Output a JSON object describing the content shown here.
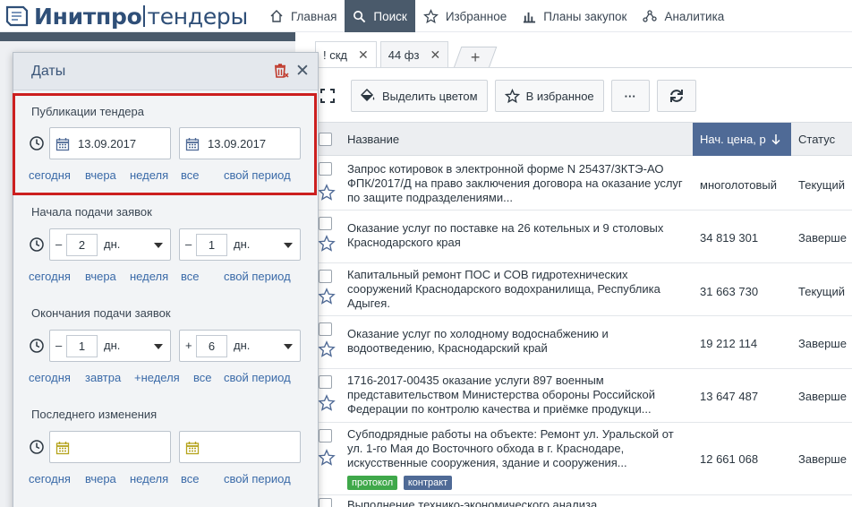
{
  "header": {
    "logo_left": "Инитпро",
    "logo_right": "тендеры",
    "nav": [
      {
        "label": "Главная",
        "icon": "home-icon",
        "active": false
      },
      {
        "label": "Поиск",
        "icon": "search-icon",
        "active": true
      },
      {
        "label": "Избранное",
        "icon": "star-icon",
        "active": false
      },
      {
        "label": "Планы закупок",
        "icon": "bar-chart-icon",
        "active": false
      },
      {
        "label": "Аналитика",
        "icon": "analytics-icon",
        "active": false
      }
    ]
  },
  "tabs": [
    {
      "label": "! скд",
      "close": "✕"
    },
    {
      "label": "44 фз",
      "close": "✕"
    }
  ],
  "tab_add": "+",
  "toolbar": {
    "highlight_label": "Выделить цветом",
    "favorite_label": "В избранное",
    "more_label": "···"
  },
  "grid": {
    "columns": {
      "name": "Название",
      "price": "Нач. цена, р",
      "status": "Статус"
    },
    "rows": [
      {
        "name": "Запрос котировок в электронной форме N 25437/3КТЭ-АО ФПК/2017/Д на право заключения договора на оказание услуг по защите подразделениями...",
        "price": "многолотовый",
        "status": "Текущий"
      },
      {
        "name": "Оказание услуг по поставке на 26 котельных и 9 столовых Краснодарского края",
        "price": "34 819 301",
        "status": "Заверше"
      },
      {
        "name": "Капитальный ремонт ПОС и СОВ гидротехнических сооружений Краснодарского водохранилища, Республика Адыгея.",
        "price": "31 663 730",
        "status": "Текущий"
      },
      {
        "name": "Оказание услуг по холодному водоснабжению и водоотведению, Краснодарский край",
        "price": "19 212 114",
        "status": "Заверше"
      },
      {
        "name": "1716-2017-00435 оказание услуги 897 военным представительством Министерства обороны Российской Федерации по контролю качества и приёмке продукци...",
        "price": "13 647 487",
        "status": "Заверше"
      },
      {
        "name": "Субподрядные работы на объекте: Ремонт ул. Уральской от ул. 1-го Мая до Восточного обхода в г. Краснодаре, искусственные сооружения, здание и сооружения...",
        "price": "12 661 068",
        "status": "Заверше",
        "badges": [
          {
            "label": "протокол",
            "color": "#3fa84a"
          },
          {
            "label": "контракт",
            "color": "#4f6a96"
          }
        ]
      },
      {
        "name": "Выполнение технико-экономического анализа",
        "price": "",
        "status": ""
      }
    ]
  },
  "panel": {
    "title": "Даты",
    "close": "✕",
    "sections": {
      "publication": {
        "title": "Публикации тендера",
        "from": "13.09.2017",
        "to": "13.09.2017",
        "links": [
          "сегодня",
          "вчера",
          "неделя",
          "все",
          "свой период"
        ]
      },
      "start": {
        "title": "Начала подачи заявок",
        "from_sign": "–",
        "from_num": "2",
        "from_unit": "дн.",
        "to_sign": "–",
        "to_num": "1",
        "to_unit": "дн.",
        "links": [
          "сегодня",
          "вчера",
          "неделя",
          "все",
          "свой период"
        ]
      },
      "end": {
        "title": "Окончания подачи заявок",
        "from_sign": "–",
        "from_num": "1",
        "from_unit": "дн.",
        "to_sign": "+",
        "to_num": "6",
        "to_unit": "дн.",
        "links": [
          "сегодня",
          "завтра",
          "+неделя",
          "все",
          "свой период"
        ]
      },
      "modified": {
        "title": "Последнего изменения",
        "from": "",
        "to": "",
        "links": [
          "сегодня",
          "вчера",
          "неделя",
          "все",
          "свой период"
        ]
      }
    }
  },
  "colors": {
    "nav_active": "#4a5a6b",
    "price_header": "#4f6a96",
    "link": "#3a6aa8",
    "highlight_border": "#cc1f1f"
  }
}
